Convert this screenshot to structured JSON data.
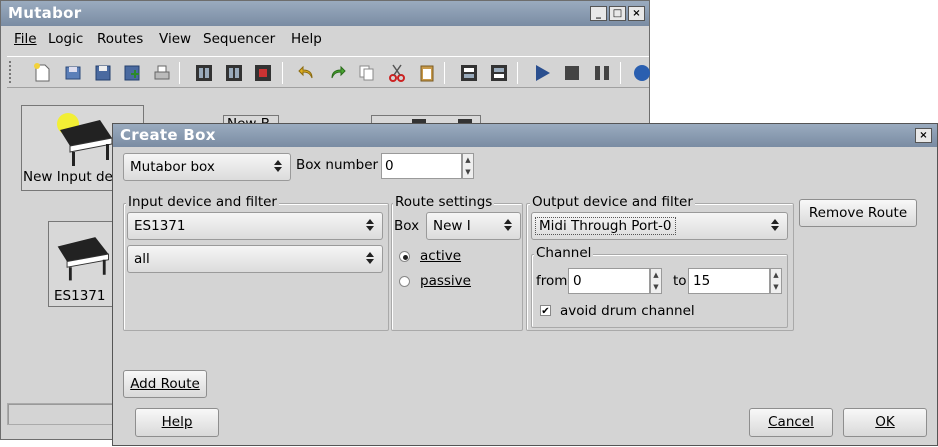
{
  "main_window": {
    "title": "Mutabor",
    "menu": [
      "File",
      "Logic",
      "Routes",
      "View",
      "Sequencer",
      "Help"
    ],
    "boxes": [
      {
        "label": "New Input de"
      },
      {
        "label": "ES1371"
      },
      {
        "label": "New B"
      }
    ]
  },
  "dialog": {
    "title": "Create Box",
    "box_type": "Mutabor box",
    "box_number_label": "Box number",
    "box_number_value": "0",
    "input_group": {
      "label": "Input device and filter",
      "device": "ES1371",
      "filter": "all"
    },
    "route_group": {
      "label": "Route settings",
      "box_label": "Box",
      "box_value": "New I",
      "active_label": "active",
      "passive_label": "passive",
      "selected": "active"
    },
    "output_group": {
      "label": "Output device and filter",
      "device": "Midi Through Port-0",
      "channel_label": "Channel",
      "from_label": "from",
      "from_value": "0",
      "to_label": "to",
      "to_value": "15",
      "avoid_drum_label": "avoid drum channel",
      "avoid_drum_checked": true
    },
    "remove_route_label": "Remove Route",
    "add_route_label": "Add Route",
    "help_label": "Help",
    "cancel_label": "Cancel",
    "ok_label": "OK"
  },
  "colors": {
    "titlebar": "#8a9bb1",
    "window_bg": "#d4d4d4",
    "toolbar_blue": "#2a4f8f"
  }
}
